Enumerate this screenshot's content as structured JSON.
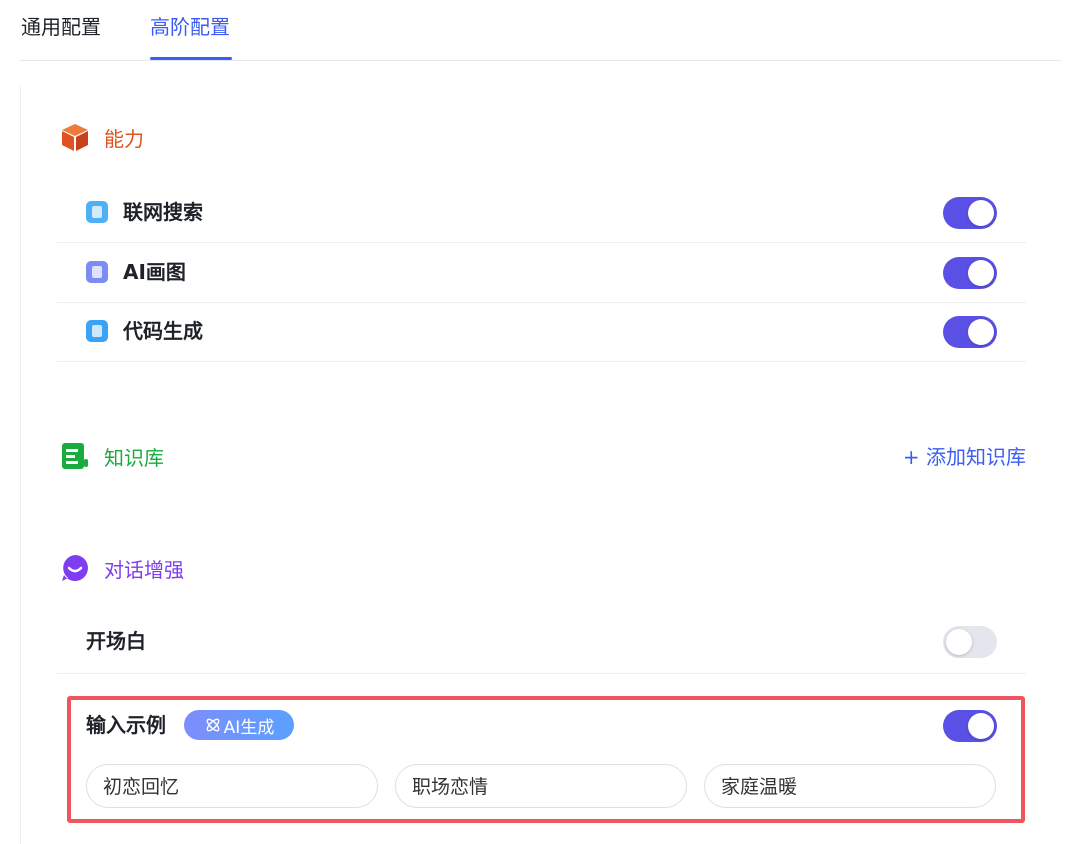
{
  "tabs": {
    "general": "通用配置",
    "advanced": "高阶配置"
  },
  "capability": {
    "title": "能力",
    "title_color": "#e0521f",
    "items": [
      {
        "label": "联网搜索",
        "icon": "web-search-icon",
        "icon_color": "#4fb0f5",
        "enabled": true
      },
      {
        "label": "AI画图",
        "icon": "ai-image-icon",
        "icon_color": "#7b8cf5",
        "enabled": true
      },
      {
        "label": "代码生成",
        "icon": "code-gen-icon",
        "icon_color": "#3aa3f5",
        "enabled": true
      }
    ]
  },
  "knowledge": {
    "title": "知识库",
    "title_color": "#1aab3e",
    "add_label": "+ 添加知识库"
  },
  "dialog": {
    "title": "对话增强",
    "title_color": "#7f3df0",
    "opening": {
      "label": "开场白",
      "enabled": false
    },
    "examples": {
      "label": "输入示例",
      "ai_badge": "AI生成",
      "enabled": true,
      "chips": [
        "初恋回忆",
        "职场恋情",
        "家庭温暖"
      ]
    }
  },
  "colors": {
    "accent": "#3b5cf5",
    "toggle_on": "#5b50e6",
    "highlight": "#f0545c"
  }
}
